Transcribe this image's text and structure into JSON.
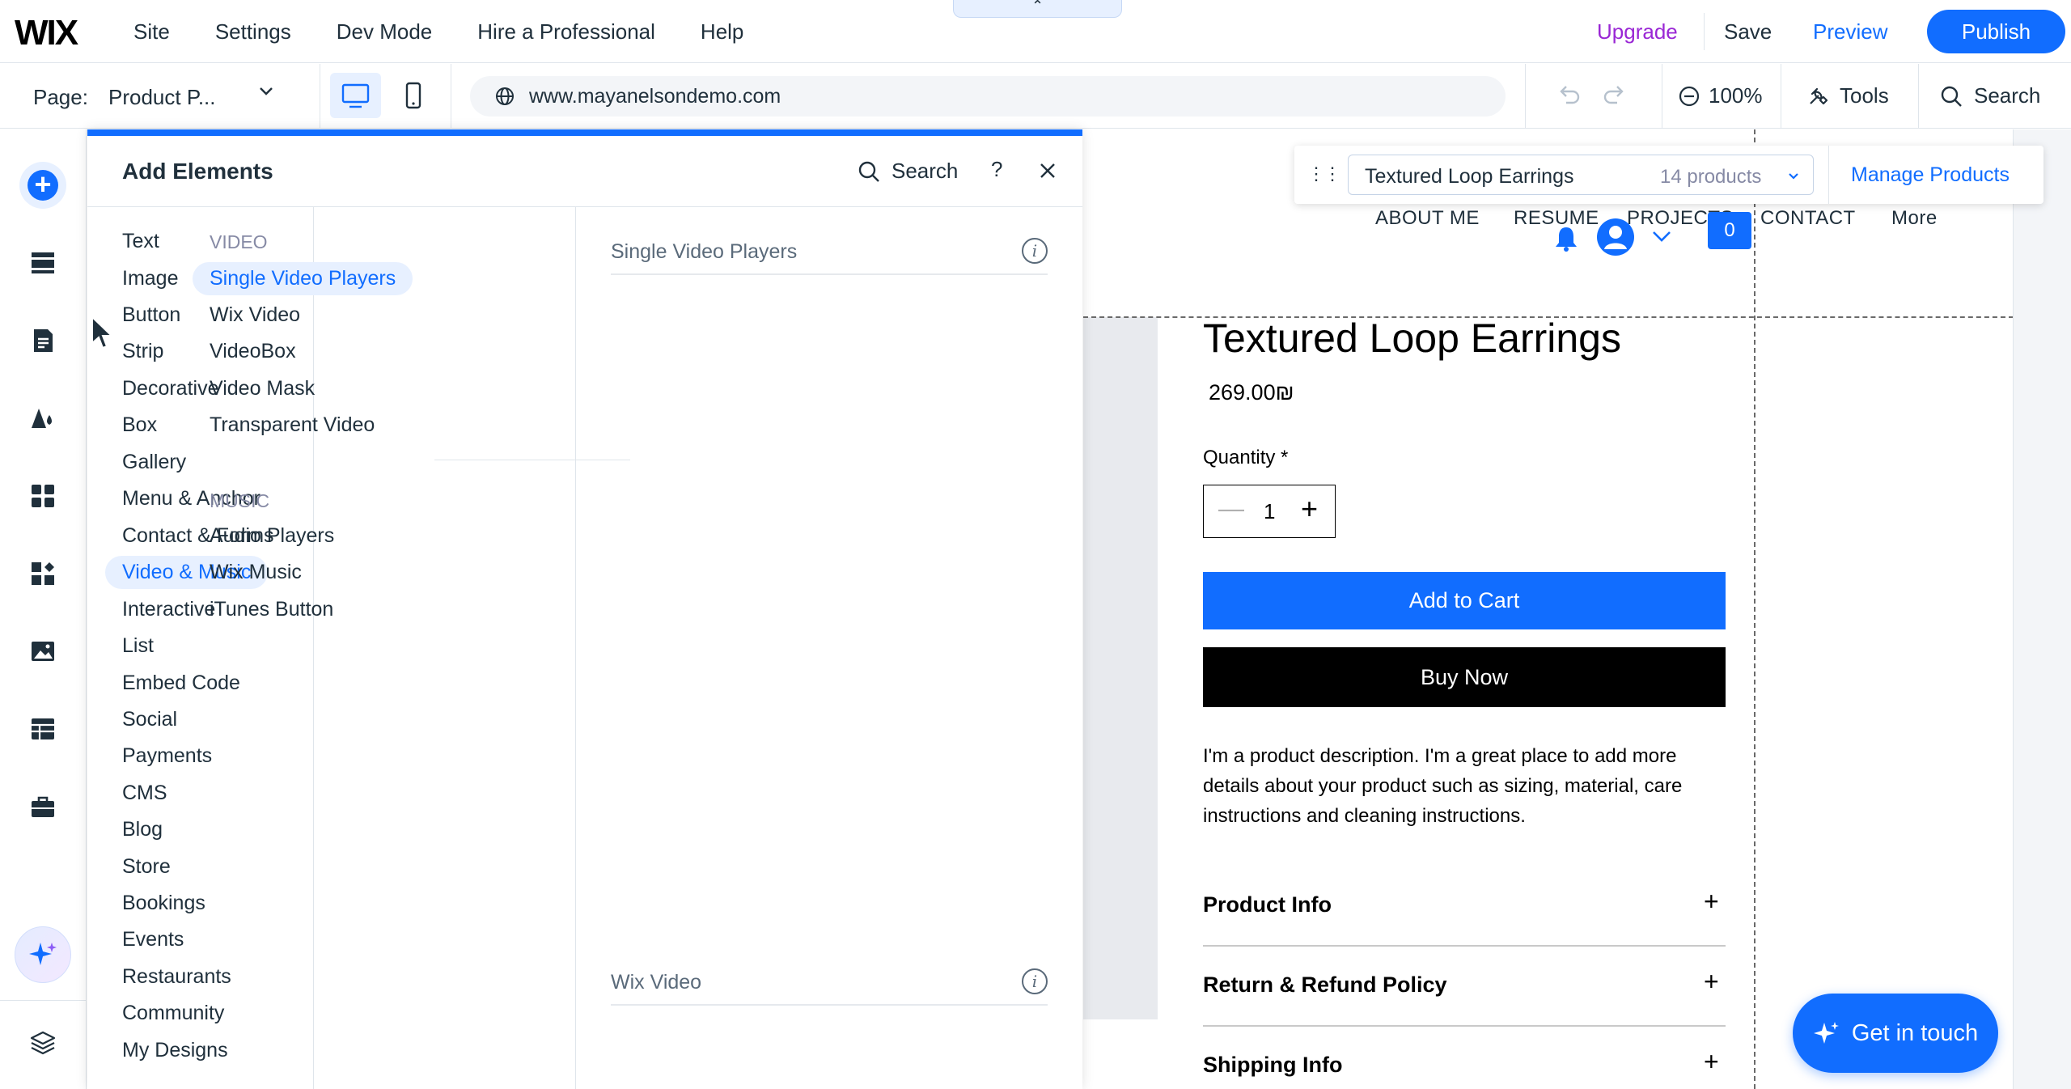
{
  "topbar": {
    "logo": "WIX",
    "menu": [
      "Site",
      "Settings",
      "Dev Mode",
      "Hire a Professional",
      "Help"
    ],
    "collapse_icon": "chevron-up-icon",
    "upgrade": "Upgrade",
    "save": "Save",
    "preview": "Preview",
    "publish": "Publish"
  },
  "secondbar": {
    "page_label": "Page:",
    "page_value": "Product P...",
    "url": "www.mayanelsondemo.com",
    "zoom": "100%",
    "tools": "Tools",
    "search": "Search"
  },
  "rail": {
    "icons": [
      "add-elements-icon",
      "sections-icon",
      "pages-icon",
      "design-icon",
      "apps-icon",
      "business-apps-icon",
      "media-icon",
      "cms-icon",
      "portfolio-icon",
      "ai-assistant-icon",
      "layers-icon"
    ]
  },
  "panel": {
    "title": "Add Elements",
    "search": "Search",
    "help": "?",
    "categories": [
      "Text",
      "Image",
      "Button",
      "Strip",
      "Decorative",
      "Box",
      "Gallery",
      "Menu & Anchor",
      "Contact & Forms",
      "Video & Music",
      "Interactive",
      "List",
      "Embed Code",
      "Social",
      "Payments",
      "CMS",
      "Blog",
      "Store",
      "Bookings",
      "Events",
      "Restaurants",
      "Community",
      "My Designs"
    ],
    "active_category": "Video & Music",
    "video_heading": "VIDEO",
    "video_items": [
      "Single Video Players",
      "Wix Video",
      "VideoBox",
      "Video Mask",
      "Transparent Video"
    ],
    "music_heading": "MUSIC",
    "music_items": [
      "Audio Players",
      "Wix Music",
      "iTunes Button"
    ],
    "sections": [
      "Single Video Players",
      "Wix Video"
    ]
  },
  "products_bar": {
    "product": "Textured Loop Earrings",
    "count": "14 products",
    "manage": "Manage Products"
  },
  "site": {
    "nav": [
      "ABOUT ME",
      "RESUME",
      "PROJECTS",
      "CONTACT",
      "More"
    ],
    "cart_count": "0",
    "title": "Textured Loop Earrings",
    "price": "269.00₪",
    "quantity_label": "Quantity *",
    "quantity": "1",
    "add_to_cart": "Add to Cart",
    "buy_now": "Buy Now",
    "description": "I'm a product description. I'm a great place to add more details about your product such as sizing, material, care instructions and cleaning instructions.",
    "accordions": [
      "Product Info",
      "Return & Refund Policy",
      "Shipping Info"
    ],
    "get_in_touch": "Get in touch"
  },
  "colors": {
    "accent": "#116dff",
    "upgrade": "#9a27d5",
    "selected_bg": "#e7f0ff"
  }
}
